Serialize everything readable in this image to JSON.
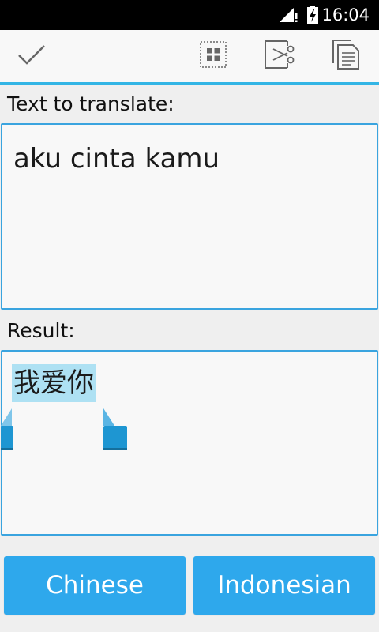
{
  "status_bar": {
    "time": "16:04",
    "icons": [
      "signal-icon",
      "battery-charging-icon"
    ]
  },
  "action_bar": {
    "icons": [
      "checkmark-icon",
      "select-all-icon",
      "cut-icon",
      "copy-icon"
    ]
  },
  "input": {
    "label": "Text to translate:",
    "value": "aku cinta kamu"
  },
  "result": {
    "label": "Result:",
    "value": "我爱你"
  },
  "languages": {
    "from": "Chinese",
    "to": "Indonesian"
  },
  "colors": {
    "accent": "#33b5e5",
    "button": "#2ea8ec",
    "selection": "#aee1f3",
    "handle": "#1e96d2"
  }
}
